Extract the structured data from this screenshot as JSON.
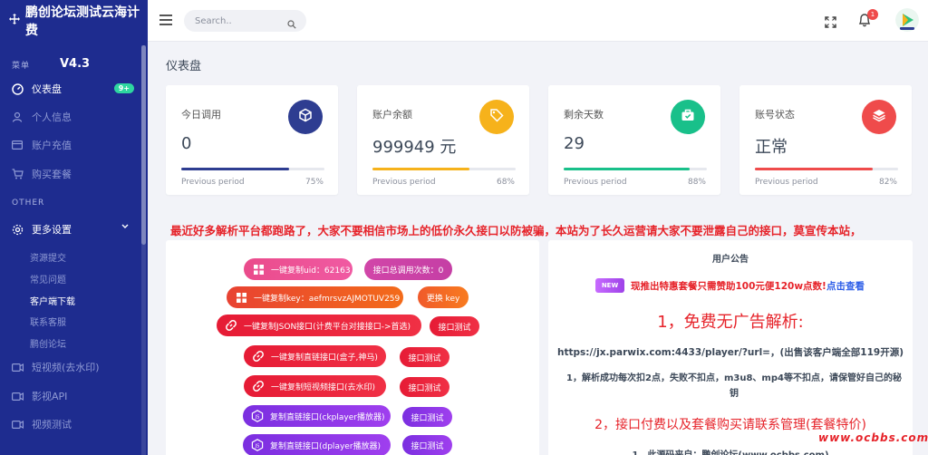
{
  "brand": {
    "title": "鹏创论坛测试云海计费"
  },
  "sidebar": {
    "menu_label": "菜单",
    "version": "V4.3",
    "items": [
      {
        "label": "仪表盘",
        "badge": "9+"
      },
      {
        "label": "个人信息"
      },
      {
        "label": "账户充值"
      },
      {
        "label": "购买套餐"
      }
    ],
    "other_label": "OTHER",
    "settings": {
      "label": "更多设置",
      "subitems": [
        "资源提交",
        "常见问题",
        "客户端下载",
        "联系客服",
        "鹏创论坛"
      ]
    },
    "bottom_items": [
      {
        "label": "短视频(去水印)"
      },
      {
        "label": "影视API"
      },
      {
        "label": "视频测试"
      }
    ]
  },
  "topbar": {
    "search_placeholder": "Search..",
    "notification_count": "1"
  },
  "page_title": "仪表盘",
  "cards": [
    {
      "label": "今日调用",
      "value": "0",
      "period": "Previous period",
      "percent_label": "75%",
      "progress": 0.75,
      "color": "#2e3d91",
      "icon": "cube-icon"
    },
    {
      "label": "账户余额",
      "value": "999949 元",
      "period": "Previous period",
      "percent_label": "68%",
      "progress": 0.68,
      "color": "#f6b21b",
      "icon": "tag-icon"
    },
    {
      "label": "剩余天数",
      "value": "29",
      "period": "Previous period",
      "percent_label": "88%",
      "progress": 0.88,
      "color": "#19c08a",
      "icon": "briefcase-icon"
    },
    {
      "label": "账号状态",
      "value": "正常",
      "period": "Previous period",
      "percent_label": "82%",
      "progress": 0.82,
      "color": "#ef4b4b",
      "icon": "layers-icon"
    }
  ],
  "notice": "最近好多解析平台都跑路了，大家不要相信市场上的低价永久接口以防被骗，本站为了长久运营请大家不要泄露自己的接口，莫宣传本站，",
  "actions": {
    "copy_uid": "一键复制uid：62163",
    "total_calls": "接口总调用次数：0",
    "copy_key": "一键复制key：aefmrsvzAJMOTUV259",
    "change_key": "更换 key",
    "copy_json": "一键复制JSON接口(计费平台对接接口->首选)",
    "test": "接口测试",
    "copy_direct": "一键复制直链接口(盒子,神马)",
    "copy_short": "一键复制短视频接口(去水印)",
    "copy_ckplayer": "复制直链接口(ckplayer播放器)",
    "copy_dplayer": "复制直链接口(dplayer播放器)"
  },
  "announcement": {
    "title": "用户公告",
    "new_badge": "NEW",
    "promo": "现推出特惠套餐只需赞助100元便120w点数!",
    "promo_link": "点击查看",
    "h1": "1，免费无广告解析:",
    "url": "https://jx.parwix.com:4433/player/?url=，(出售该客户端全部119开源)",
    "p1": "1，解析成功每次扣2点，失败不扣点，m3u8、mp4等不扣点，请保管好自己的秘钥",
    "h2": "2，接口付费以及套餐购买请联系管理(套餐特价)",
    "source": "1，此源码来自：鹏创论坛(www.ocbbs.com)"
  },
  "watermark": "www.ocbbs.com"
}
